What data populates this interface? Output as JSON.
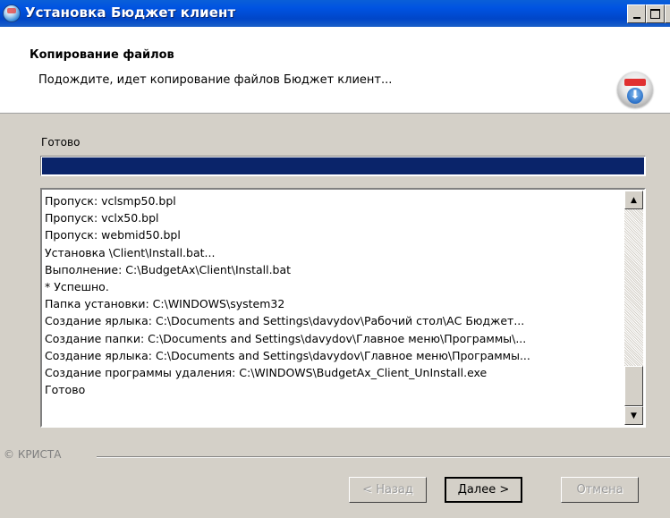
{
  "window": {
    "title": "Установка Бюджет клиент"
  },
  "header": {
    "title": "Копирование файлов",
    "subtitle": "Подождите, идет копирование файлов Бюджет клиент..."
  },
  "status": {
    "label": "Готово",
    "progress_fraction": 1.0
  },
  "log": [
    "Пропуск: vclsmp50.bpl",
    "Пропуск: vclx50.bpl",
    "Пропуск: webmid50.bpl",
    "Установка \\Client\\Install.bat...",
    "Выполнение: C:\\BudgetAx\\Client\\Install.bat",
    "* Успешно.",
    "Папка установки: C:\\WINDOWS\\system32",
    "Создание ярлыка: C:\\Documents and Settings\\davydov\\Рабочий стол\\АС Бюджет...",
    "Создание папки: C:\\Documents and Settings\\davydov\\Главное меню\\Программы\\...",
    "Создание ярлыка: C:\\Documents and Settings\\davydov\\Главное меню\\Программы...",
    "Создание программы удаления: C:\\WINDOWS\\BudgetAx_Client_UnInstall.exe",
    "Готово"
  ],
  "footer": {
    "brand": "© КРИСТА",
    "back_label": "< Назад",
    "next_label": "Далее >",
    "cancel_label": "Отмена"
  },
  "colors": {
    "titlebar": "#0053e1",
    "progress": "#0a246a",
    "dialog_bg": "#d4d0c8"
  },
  "icons": {
    "app": "installer-globe-icon",
    "header": "install-disc-icon"
  }
}
